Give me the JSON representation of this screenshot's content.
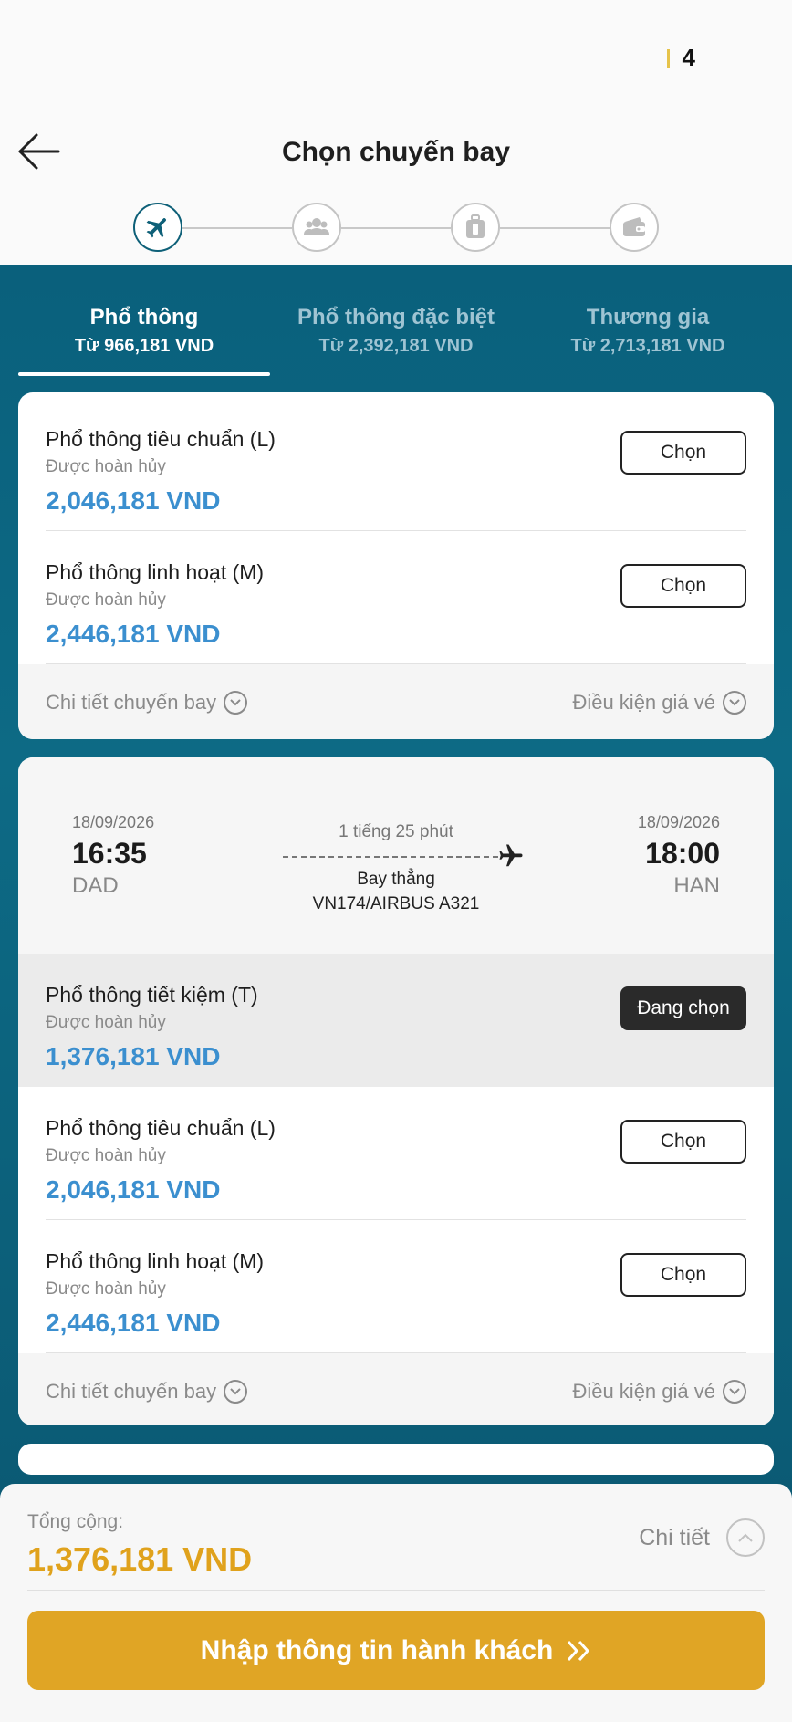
{
  "status": {
    "number": "4"
  },
  "header": {
    "title": "Chọn chuyến bay"
  },
  "steps": [
    {
      "icon": "airplane-icon",
      "active": true
    },
    {
      "icon": "passengers-icon",
      "active": false
    },
    {
      "icon": "baggage-icon",
      "active": false
    },
    {
      "icon": "wallet-icon",
      "active": false
    }
  ],
  "tabs": [
    {
      "name": "Phổ thông",
      "price": "Từ 966,181 VND",
      "active": true
    },
    {
      "name": "Phổ thông đặc biệt",
      "price": "Từ 2,392,181 VND",
      "active": false
    },
    {
      "name": "Thương gia",
      "price": "Từ 2,713,181 VND",
      "active": false
    }
  ],
  "card1": {
    "fares": [
      {
        "name": "Phổ thông tiêu chuẩn (L)",
        "refund": "Được hoàn hủy",
        "price": "2,046,181 VND",
        "button": "Chọn"
      },
      {
        "name": "Phổ thông linh hoạt (M)",
        "refund": "Được hoàn hủy",
        "price": "2,446,181 VND",
        "button": "Chọn"
      }
    ],
    "footer": {
      "details": "Chi tiết chuyến bay",
      "conditions": "Điều kiện giá vé"
    }
  },
  "card2": {
    "flight": {
      "dep_date": "18/09/2026",
      "dep_time": "16:35",
      "dep_code": "DAD",
      "arr_date": "18/09/2026",
      "arr_time": "18:00",
      "arr_code": "HAN",
      "duration": "1 tiếng 25 phút",
      "type": "Bay thẳng",
      "number": "VN174/AIRBUS A321"
    },
    "fares": [
      {
        "name": "Phổ thông tiết kiệm (T)",
        "refund": "Được hoàn hủy",
        "price": "1,376,181 VND",
        "button": "Đang chọn",
        "selected": true
      },
      {
        "name": "Phổ thông tiêu chuẩn (L)",
        "refund": "Được hoàn hủy",
        "price": "2,046,181 VND",
        "button": "Chọn"
      },
      {
        "name": "Phổ thông linh hoạt (M)",
        "refund": "Được hoàn hủy",
        "price": "2,446,181 VND",
        "button": "Chọn"
      }
    ],
    "footer": {
      "details": "Chi tiết chuyến bay",
      "conditions": "Điều kiện giá vé"
    }
  },
  "summary": {
    "total_label": "Tổng cộng:",
    "total_price": "1,376,181 VND",
    "detail_label": "Chi tiết",
    "cta_label": "Nhập thông tin hành khách"
  },
  "colors": {
    "teal": "#0a607c",
    "price_blue": "#3b8fcf",
    "gold": "#e0a525",
    "selected_button": "#2a2a2a"
  }
}
